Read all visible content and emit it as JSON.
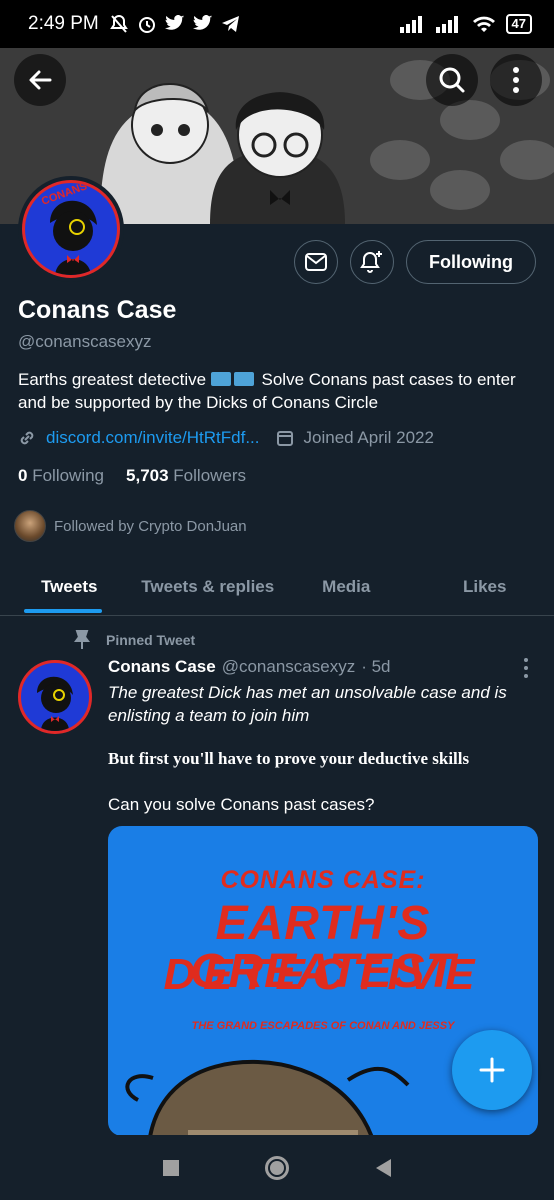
{
  "status_bar": {
    "time": "2:49 PM",
    "battery": "47"
  },
  "profile": {
    "name": "Conans Case",
    "handle": "@conanscasexyz",
    "bio_line1": "Earths greatest detective",
    "bio_line1_tail": "Solve Conans past cases to enter",
    "bio_line2": "and be supported by the Dicks of Conans Circle",
    "website": "discord.com/invite/HtRtFdf...",
    "joined": "Joined April 2022",
    "following_count": "0",
    "following_label": "Following",
    "followers_count": "5,703",
    "followers_label": "Followers",
    "followed_by": "Followed by Crypto DonJuan",
    "following_button": "Following"
  },
  "tabs": [
    {
      "label": "Tweets",
      "active": true
    },
    {
      "label": "Tweets & replies",
      "active": false
    },
    {
      "label": "Media",
      "active": false
    },
    {
      "label": "Likes",
      "active": false
    }
  ],
  "pinned_tweet": {
    "pinned_label": "Pinned Tweet",
    "author": "Conans Case",
    "handle": "@conanscasexyz",
    "time": "· 5d",
    "text": "The greatest Dick has met an unsolvable case and is enlisting a team to join him",
    "bold_text": "But first you'll have to prove your deductive skills",
    "question": "Can you solve Conans past cases?",
    "media": {
      "line1": "CONANS CASE:",
      "line2": "EARTH'S GREATEST",
      "line3": "DETECTIVE",
      "subtitle": "THE GRAND ESCAPADES OF CONAN AND JESSY"
    }
  },
  "colors": {
    "background": "#15202b",
    "accent": "#1d9bf0",
    "muted": "#8b98a5"
  },
  "icons": [
    "back-arrow-icon",
    "search-icon",
    "more-vertical-icon",
    "mail-icon",
    "bell-plus-icon",
    "link-icon",
    "calendar-icon",
    "pin-icon",
    "compose-plus-icon"
  ]
}
